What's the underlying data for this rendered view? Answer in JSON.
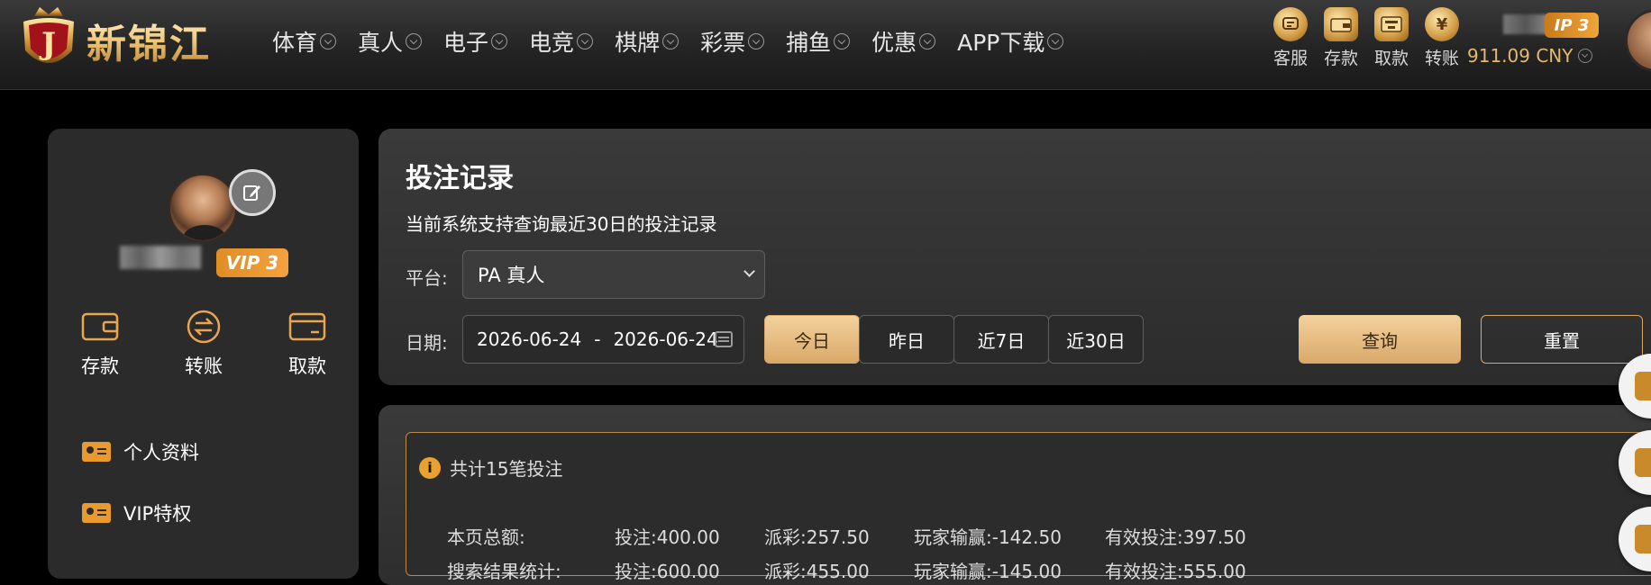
{
  "brand": {
    "name": "新锦江",
    "badge_letter": "J"
  },
  "nav": {
    "items": [
      {
        "label": "体育"
      },
      {
        "label": "真人"
      },
      {
        "label": "电子"
      },
      {
        "label": "电竞"
      },
      {
        "label": "棋牌"
      },
      {
        "label": "彩票"
      },
      {
        "label": "捕鱼"
      },
      {
        "label": "优惠"
      },
      {
        "label": "APP下载"
      }
    ]
  },
  "top_actions": [
    {
      "label": "客服",
      "icon": "chat-icon"
    },
    {
      "label": "存款",
      "icon": "wallet-icon"
    },
    {
      "label": "取款",
      "icon": "atm-icon"
    },
    {
      "label": "转账",
      "icon": "yuan-coin-icon"
    }
  ],
  "user": {
    "vip_badge": "IP 3",
    "vip_label": "VIP 3",
    "balance": "911.09 CNY"
  },
  "sidebar": {
    "quick": [
      {
        "label": "存款",
        "icon": "wallet-icon"
      },
      {
        "label": "转账",
        "icon": "transfer-icon"
      },
      {
        "label": "取款",
        "icon": "card-icon"
      }
    ],
    "menu": [
      {
        "label": "个人资料",
        "icon": "id-card-icon"
      },
      {
        "label": "VIP特权",
        "icon": "id-card-icon"
      }
    ]
  },
  "filters": {
    "title": "投注记录",
    "note": "当前系统支持查询最近30日的投注记录",
    "platform_label": "平台:",
    "platform_value": "PA 真人",
    "date_label": "日期:",
    "date_start": "2026-06-24",
    "date_sep": "-",
    "date_end": "2026-06-24",
    "quick_ranges": [
      "今日",
      "昨日",
      "近7日",
      "近30日"
    ],
    "active_range": "今日",
    "query_label": "查询",
    "reset_label": "重置"
  },
  "summary": {
    "total_text": "共计15笔投注",
    "rows": [
      {
        "label": "本页总额:",
        "bet": "投注:400.00",
        "payout": "派彩:257.50",
        "win_loss": "玩家输赢:-142.50",
        "valid": "有效投注:397.50"
      },
      {
        "label": "搜索结果统计:",
        "bet": "投注:600.00",
        "payout": "派彩:455.00",
        "win_loss": "玩家输赢:-145.00",
        "valid": "有效投注:555.00"
      }
    ]
  },
  "colors": {
    "accent_gold": "#d9a869",
    "vip_orange": "#f0a53b",
    "panel_bg": "#2b2b2b"
  }
}
